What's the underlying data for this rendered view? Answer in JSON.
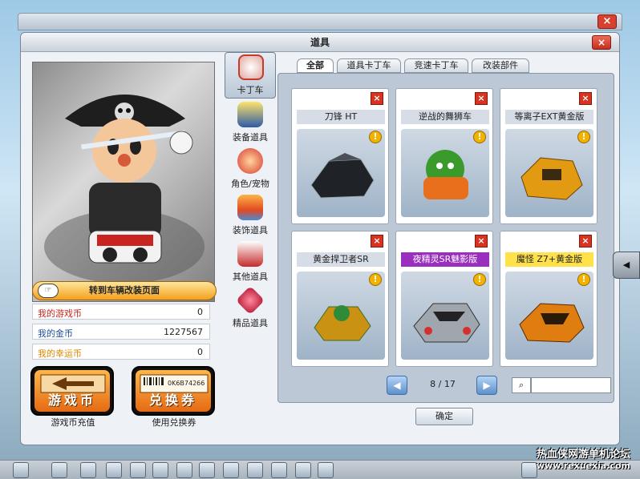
{
  "outer": {
    "close": "×"
  },
  "window": {
    "title": "道具",
    "close": "×"
  },
  "avatar": {
    "goto_button": "转到车辆改装页面",
    "hand": "☞"
  },
  "stats": [
    {
      "label": "我的游戏币",
      "value": "0",
      "color": "#c5281c"
    },
    {
      "label": "我的金币",
      "value": "1227567",
      "color": "#1b4f9d"
    },
    {
      "label": "我的幸运币",
      "value": "0",
      "color": "#e38700"
    }
  ],
  "buttons": {
    "game_coin": {
      "big": "游戏币",
      "caption": "游戏币充值"
    },
    "voucher": {
      "big": "兑换券",
      "caption": "使用兑换券",
      "barcode": "0K6B74266"
    }
  },
  "categories": [
    {
      "label": "卡丁车",
      "icon": "kart-icon",
      "color": "#c43b2c"
    },
    {
      "label": "装备道具",
      "icon": "equipment-icon",
      "color": "#2d5aa8"
    },
    {
      "label": "角色/宠物",
      "icon": "pet-icon",
      "color": "#d93a2c"
    },
    {
      "label": "装饰道具",
      "icon": "decoration-icon",
      "color": "#e04a20"
    },
    {
      "label": "其他道具",
      "icon": "gift-icon",
      "color": "#c42b2b"
    },
    {
      "label": "精品道具",
      "icon": "gem-icon",
      "color": "#b3122e"
    }
  ],
  "tabs": [
    "全部",
    "道具卡丁车",
    "竞速卡丁车",
    "改装部件"
  ],
  "items": [
    {
      "name": "刀锋 HT",
      "name_bg": "#d6dde6",
      "name_color": "#222",
      "icon": "kart-blade-ht-icon",
      "color": "#1f2328"
    },
    {
      "name": "逆战的舞狮车",
      "name_bg": "#d6dde6",
      "name_color": "#222",
      "icon": "kart-lion-dance-icon",
      "color": "#3a9a2b"
    },
    {
      "name": "等离子EXT黄金版",
      "name_bg": "#d6dde6",
      "name_color": "#222",
      "icon": "kart-plasma-gold-icon",
      "color": "#e29a12"
    },
    {
      "name": "黄金捍卫者SR",
      "name_bg": "#d6dde6",
      "name_color": "#222",
      "icon": "kart-golden-guardian-icon",
      "color": "#c99213"
    },
    {
      "name": "夜精灵SR魅影版",
      "name_bg": "#9a2fbf",
      "name_color": "#ffffff",
      "icon": "kart-night-elf-icon",
      "color": "#a0a6ad"
    },
    {
      "name": "魔怪 Z7+黄金版",
      "name_bg": "#ffe24a",
      "name_color": "#222",
      "icon": "kart-monster-gold-icon",
      "color": "#e07d10"
    }
  ],
  "pager": {
    "text": "8 / 17",
    "prev": "◀",
    "next": "▶"
  },
  "search": {
    "icon": "⌕",
    "placeholder": ""
  },
  "ok_button": "确定",
  "sidegrip": "◀",
  "watermark": {
    "line1": "热血侠网游单机论坛",
    "line2": "www.rexuexia.com"
  }
}
